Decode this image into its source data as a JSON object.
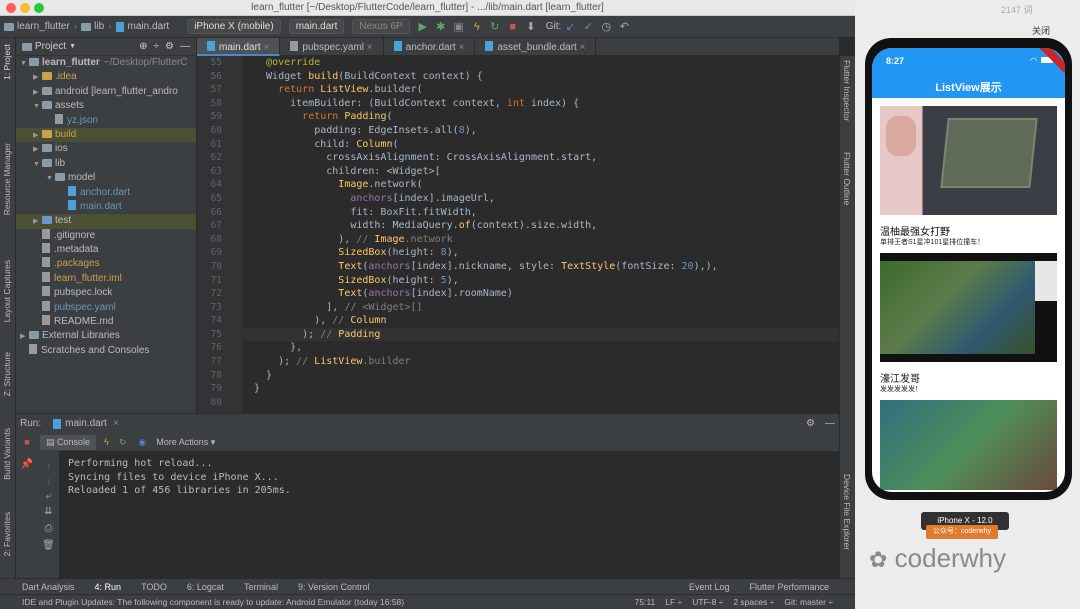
{
  "window": {
    "title": "learn_flutter [~/Desktop/FlutterCode/learn_flutter] - .../lib/main.dart [learn_flutter]"
  },
  "toolbar": {
    "crumbs": [
      "learn_flutter",
      "lib",
      "main.dart"
    ],
    "device": "iPhone X (mobile)",
    "run_config": "main.dart",
    "avd": "Nexus 6P",
    "git_label": "Git:"
  },
  "left_tabs": [
    "1: Project",
    "Resource Manager",
    "Layout Captures",
    "Z: Structure",
    "Build Variants",
    "2: Favorites"
  ],
  "right_tabs": [
    "Flutter Inspector",
    "Flutter Outline",
    "Device File Explorer"
  ],
  "project": {
    "header": "Project",
    "tree": [
      {
        "label": "learn_flutter",
        "extra": "~/Desktop/FlutterC",
        "indent": 0,
        "kind": "folder",
        "open": true
      },
      {
        "label": ".idea",
        "indent": 1,
        "kind": "folder-y",
        "open": false
      },
      {
        "label": "android [learn_flutter_andro",
        "indent": 1,
        "kind": "folder",
        "open": false
      },
      {
        "label": "assets",
        "indent": 1,
        "kind": "folder",
        "open": true
      },
      {
        "label": "yz.json",
        "indent": 2,
        "kind": "file"
      },
      {
        "label": "build",
        "indent": 1,
        "kind": "folder-y",
        "open": false
      },
      {
        "label": "ios",
        "indent": 1,
        "kind": "folder",
        "open": false
      },
      {
        "label": "lib",
        "indent": 1,
        "kind": "folder",
        "open": true
      },
      {
        "label": "model",
        "indent": 2,
        "kind": "folder",
        "open": true
      },
      {
        "label": "anchor.dart",
        "indent": 3,
        "kind": "dart"
      },
      {
        "label": "main.dart",
        "indent": 3,
        "kind": "dart"
      },
      {
        "label": "test",
        "indent": 1,
        "kind": "folder-b",
        "open": false
      },
      {
        "label": ".gitignore",
        "indent": 1,
        "kind": "file"
      },
      {
        "label": ".metadata",
        "indent": 1,
        "kind": "file"
      },
      {
        "label": ".packages",
        "indent": 1,
        "kind": "file"
      },
      {
        "label": "learn_flutter.iml",
        "indent": 1,
        "kind": "file"
      },
      {
        "label": "pubspec.lock",
        "indent": 1,
        "kind": "file"
      },
      {
        "label": "pubspec.yaml",
        "indent": 1,
        "kind": "file"
      },
      {
        "label": "README.md",
        "indent": 1,
        "kind": "file"
      },
      {
        "label": "External Libraries",
        "indent": 0,
        "kind": "folder",
        "open": false
      },
      {
        "label": "Scratches and Consoles",
        "indent": 0,
        "kind": "file"
      }
    ]
  },
  "editor": {
    "tabs": [
      "main.dart",
      "pubspec.yaml",
      "anchor.dart",
      "asset_bundle.dart"
    ],
    "line_numbers": [
      "55",
      "56",
      "57",
      "58",
      "59",
      "60",
      "61",
      "62",
      "63",
      "64",
      "65",
      "66",
      "67",
      "68",
      "69",
      "70",
      "71",
      "72",
      "73",
      "74",
      "75",
      "76",
      "77",
      "78",
      "79",
      "80"
    ],
    "lines": [
      "  @override",
      "  Widget build(BuildContext context) {",
      "    return ListView.builder(",
      "      itemBuilder: (BuildContext context, int index) {",
      "        return Padding(",
      "          padding: EdgeInsets.all(8),",
      "          child: Column(",
      "            crossAxisAlignment: CrossAxisAlignment.start,",
      "            children: <Widget>[",
      "              Image.network(",
      "                anchors[index].imageUrl,",
      "                fit: BoxFit.fitWidth,",
      "                width: MediaQuery.of(context).size.width,",
      "              ), // Image.network",
      "              SizedBox(height: 8),",
      "              Text(anchors[index].nickname, style: TextStyle(fontSize: 20),),",
      "              SizedBox(height: 5),",
      "              Text(anchors[index].roomName)",
      "            ], // <Widget>[]",
      "          ), // Column",
      "        ); // Padding",
      "      },",
      "    ); // ListView.builder",
      "  }",
      "}",
      ""
    ]
  },
  "run": {
    "label": "Run:",
    "config": "main.dart",
    "console_tab": "Console",
    "more_actions": "More Actions",
    "output": [
      "Performing hot reload...",
      "Syncing files to device iPhone X...",
      "Reloaded 1 of 456 libraries in 205ms."
    ]
  },
  "bottom_tools": [
    "Dart Analysis",
    "4: Run",
    "TODO",
    "6: Logcat",
    "Terminal",
    "9: Version Control",
    "Event Log",
    "Flutter Performance"
  ],
  "status": {
    "message": "IDE and Plugin Updates: The following component is ready to update: Android Emulator (today 16:58)",
    "position": "75:11",
    "line_sep": "LF ÷",
    "encoding": "UTF-8 ÷",
    "indent": "2 spaces ÷",
    "vcs": "Git: master ÷"
  },
  "simulator": {
    "time": "8:27",
    "app_title": "ListView展示",
    "close_label": "关闭",
    "corner_text": "2147 词",
    "badge_text": "iPhone X - 12.0",
    "items": [
      {
        "nickname": "温柚最强女打野",
        "room": "单排王者S1星冲101星排位撞车！"
      },
      {
        "nickname": "濠江发哥",
        "room": "发发发发发！"
      }
    ]
  },
  "watermark": {
    "account": "公众号：coderwhy",
    "brand": "coderwhy"
  },
  "colors": {
    "ide_bg": "#2b2b2b",
    "panel_bg": "#3c3f41",
    "appbar": "#2196f3",
    "keyword": "#cc7832"
  }
}
